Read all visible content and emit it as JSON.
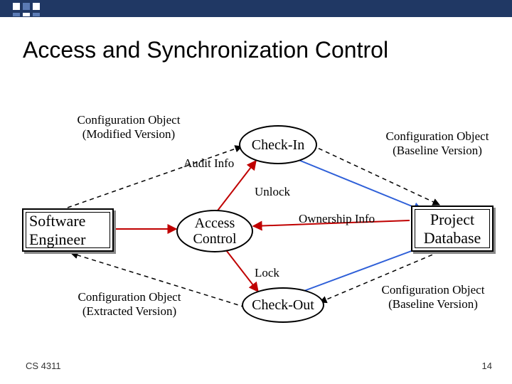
{
  "slide": {
    "title": "Access and Synchronization Control",
    "footer_left": "CS 4311",
    "footer_right": "14"
  },
  "nodes": {
    "software_engineer": "Software\nEngineer",
    "project_database": "Project\nDatabase",
    "check_in": "Check-In",
    "check_out": "Check-Out",
    "access_control": "Access\nControl"
  },
  "labels": {
    "config_modified": "Configuration Object\n(Modified Version)",
    "config_baseline_top": "Configuration Object\n(Baseline Version)",
    "config_baseline_bottom": "Configuration Object\n(Baseline Version)",
    "config_extracted": "Configuration Object\n(Extracted Version)",
    "audit_info": "Audit Info",
    "ownership_info": "Ownership Info",
    "unlock": "Unlock",
    "lock": "Lock"
  },
  "chart_data": {
    "type": "diagram",
    "title": "Access and Synchronization Control",
    "nodes": [
      {
        "id": "software_engineer",
        "label": "Software Engineer",
        "shape": "rect"
      },
      {
        "id": "project_database",
        "label": "Project Database",
        "shape": "rect"
      },
      {
        "id": "check_in",
        "label": "Check-In",
        "shape": "oval"
      },
      {
        "id": "check_out",
        "label": "Check-Out",
        "shape": "oval"
      },
      {
        "id": "access_control",
        "label": "Access Control",
        "shape": "oval"
      }
    ],
    "edges": [
      {
        "from": "software_engineer",
        "to": "check_in",
        "style": "dashed",
        "label": "Configuration Object (Modified Version)"
      },
      {
        "from": "check_in",
        "to": "project_database",
        "style": "dashed",
        "label": "Configuration Object (Baseline Version)"
      },
      {
        "from": "access_control",
        "to": "check_in",
        "style": "solid-red",
        "label": "Audit Info"
      },
      {
        "from": "check_in",
        "to": "project_database",
        "style": "solid-blue",
        "label": "Unlock"
      },
      {
        "from": "project_database",
        "to": "access_control",
        "style": "solid-red",
        "label": "Ownership Info"
      },
      {
        "from": "check_out",
        "to": "software_engineer",
        "style": "dashed",
        "label": "Configuration Object (Extracted Version)"
      },
      {
        "from": "project_database",
        "to": "check_out",
        "style": "dashed",
        "label": "Configuration Object (Baseline Version)"
      },
      {
        "from": "check_out",
        "to": "project_database",
        "style": "solid-blue",
        "label": "Lock"
      },
      {
        "from": "software_engineer",
        "to": "access_control",
        "style": "solid-red"
      },
      {
        "from": "access_control",
        "to": "check_out",
        "style": "solid-red"
      }
    ]
  }
}
